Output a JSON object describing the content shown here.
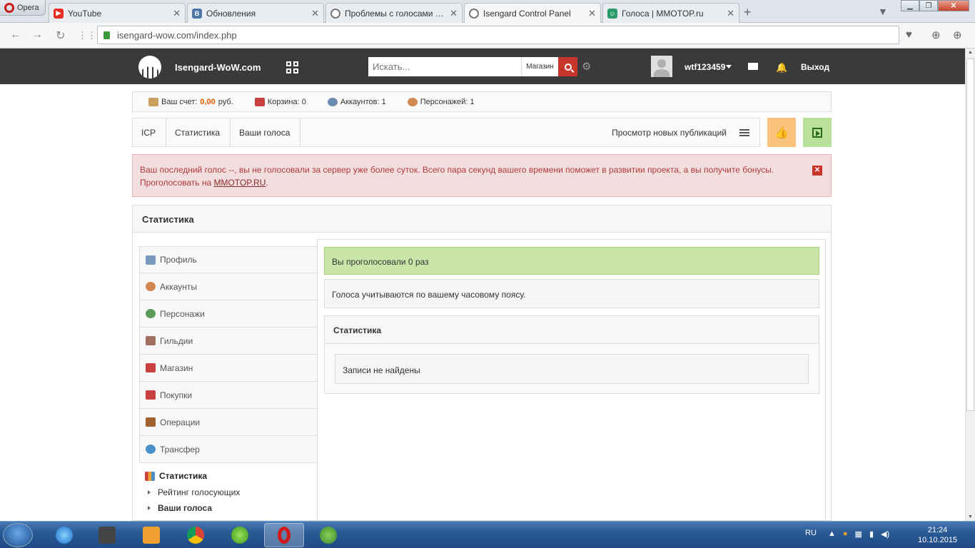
{
  "browser": {
    "menu_label": "Opera",
    "tabs": [
      {
        "title": "YouTube",
        "icon": "youtube-icon",
        "color": "#e52d27"
      },
      {
        "title": "Обновления",
        "icon": "vk-icon",
        "color": "#4a76a8"
      },
      {
        "title": "Проблемы с голосами (ОБ",
        "icon": "site-icon",
        "color": "#777777"
      },
      {
        "title": "Isengard Control Panel",
        "icon": "site-icon",
        "color": "#777777",
        "active": true
      },
      {
        "title": "Голоса | MMOTOP.ru",
        "icon": "mmotop-icon",
        "color": "#2a9a6a"
      }
    ],
    "url": "isengard-wow.com/index.php"
  },
  "header": {
    "site_name": "Isengard-WoW.com",
    "search_placeholder": "Искать...",
    "shop_label": "Магазин",
    "username": "wtf123459",
    "logout_label": "Выход"
  },
  "infobar": {
    "balance_label": "Ваш счет:",
    "balance_value": "0,00",
    "currency": "руб.",
    "cart": "Корзина: 0",
    "accounts": "Аккаунтов: 1",
    "characters": "Персонажей: 1"
  },
  "breadcrumbs": [
    "ICP",
    "Статистика",
    "Ваши голоса"
  ],
  "view_new_posts": "Просмотр новых публикаций",
  "alert": {
    "text": "Ваш последний голос --, вы не голосовали за сервер уже более суток. Всего пара секунд вашего времени поможет в развитии проекта, а вы получите бонусы. Проголосовать на ",
    "link": "MMOTOP.RU",
    "after": "."
  },
  "panel_title": "Статистика",
  "sidebar": {
    "items": [
      {
        "label": "Профиль",
        "color": "#7a9ac0"
      },
      {
        "label": "Аккаунты",
        "color": "#d08850"
      },
      {
        "label": "Персонажи",
        "color": "#5a9a5a"
      },
      {
        "label": "Гильдии",
        "color": "#a07060"
      },
      {
        "label": "Магазин",
        "color": "#c84040"
      },
      {
        "label": "Покупки",
        "color": "#c84040"
      },
      {
        "label": "Операции",
        "color": "#a06030"
      },
      {
        "label": "Трансфер",
        "color": "#4a90c8"
      }
    ],
    "section_title": "Статистика",
    "sub_items": [
      "Рейтинг голосующих",
      "Ваши голоса"
    ]
  },
  "main": {
    "success_text": "Вы проголосовали 0 раз",
    "note_text": "Голоса учитываются по вашему часовому поясу.",
    "stats_title": "Статистика",
    "empty_text": "Записи не найдены"
  },
  "taskbar": {
    "lang": "RU",
    "time": "21:24",
    "date": "10.10.2015"
  }
}
